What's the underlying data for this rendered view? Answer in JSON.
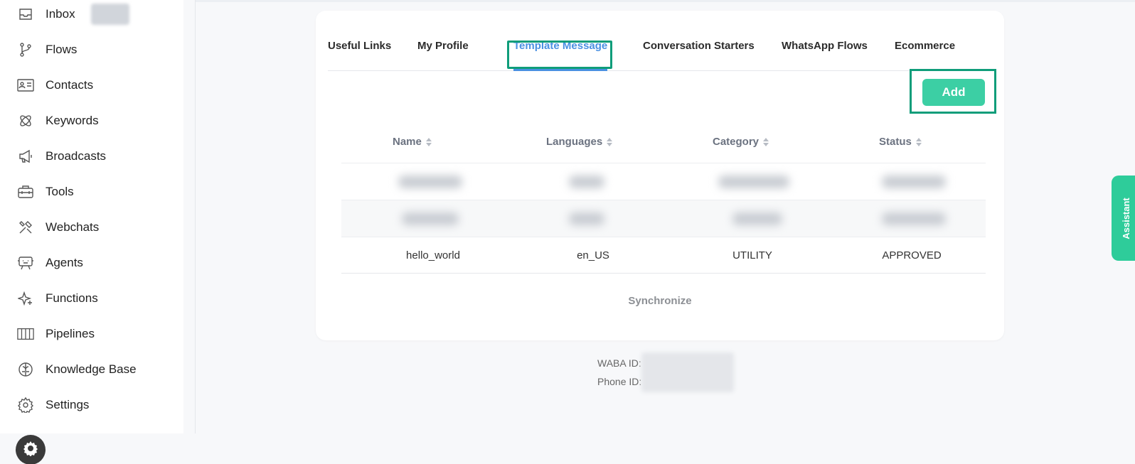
{
  "sidebar": {
    "items": [
      {
        "label": "Inbox",
        "icon": "inbox-icon"
      },
      {
        "label": "Flows",
        "icon": "flows-icon"
      },
      {
        "label": "Contacts",
        "icon": "contacts-icon"
      },
      {
        "label": "Keywords",
        "icon": "keywords-icon"
      },
      {
        "label": "Broadcasts",
        "icon": "megaphone-icon"
      },
      {
        "label": "Tools",
        "icon": "toolbox-icon"
      },
      {
        "label": "Webchats",
        "icon": "tools-icon"
      },
      {
        "label": "Agents",
        "icon": "agent-icon"
      },
      {
        "label": "Functions",
        "icon": "sparkles-icon"
      },
      {
        "label": "Pipelines",
        "icon": "pipelines-icon"
      },
      {
        "label": "Knowledge Base",
        "icon": "brain-icon"
      },
      {
        "label": "Settings",
        "icon": "gear-icon"
      }
    ]
  },
  "tabs": [
    "Useful Links",
    "My Profile",
    "Template Message",
    "Conversation Starters",
    "WhatsApp Flows",
    "Ecommerce"
  ],
  "active_tab": "Template Message",
  "add_label": "Add",
  "table": {
    "headers": [
      "Name",
      "Languages",
      "Category",
      "Status"
    ],
    "rows": [
      {
        "name": "hello_world",
        "language": "en_US",
        "category": "UTILITY",
        "status": "APPROVED"
      }
    ]
  },
  "sync_label": "Synchronize",
  "waba": {
    "waba_label": "WABA ID:",
    "phone_label": "Phone ID:"
  },
  "assistant_label": "Assistant",
  "colors": {
    "accent": "#3ccfa4",
    "tab_active": "#4a90e2",
    "highlight": "#0f9d7a"
  }
}
